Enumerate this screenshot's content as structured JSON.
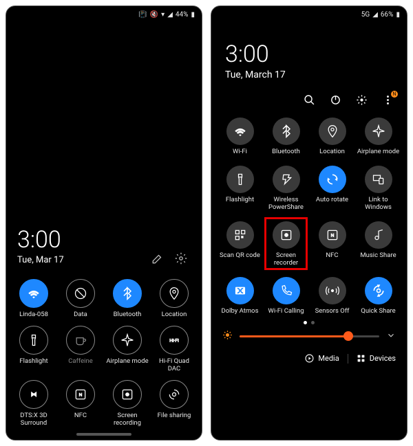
{
  "left": {
    "status": {
      "battery": "44%"
    },
    "clock": {
      "time": "3:00",
      "date": "Tue, Mar 17"
    },
    "tiles": [
      {
        "name": "wifi",
        "label": "Linda-058",
        "active": true
      },
      {
        "name": "data",
        "label": "Data"
      },
      {
        "name": "bluetooth",
        "label": "Bluetooth",
        "active": true
      },
      {
        "name": "location",
        "label": "Location"
      },
      {
        "name": "flashlight",
        "label": "Flashlight"
      },
      {
        "name": "caffeine",
        "label": "Caffeine",
        "dim": true
      },
      {
        "name": "airplane",
        "label": "Airplane mode"
      },
      {
        "name": "hifi",
        "label": "Hi-Fi Quad DAC"
      },
      {
        "name": "dtsx",
        "label": "DTS:X 3D Surround"
      },
      {
        "name": "nfc",
        "label": "NFC"
      },
      {
        "name": "screenrec",
        "label": "Screen recording"
      },
      {
        "name": "fileshare",
        "label": "File sharing"
      }
    ]
  },
  "right": {
    "status": {
      "network": "5G",
      "battery": "66%"
    },
    "clock": {
      "time": "3:00",
      "date": "Tue, March 17"
    },
    "badge": "N",
    "tiles": [
      {
        "name": "wifi",
        "label": "Wi-Fi"
      },
      {
        "name": "bluetooth",
        "label": "Bluetooth"
      },
      {
        "name": "location",
        "label": "Location"
      },
      {
        "name": "airplane",
        "label": "Airplane mode"
      },
      {
        "name": "flashlight",
        "label": "Flashlight"
      },
      {
        "name": "powershare",
        "label": "Wireless PowerShare"
      },
      {
        "name": "autorotate",
        "label": "Auto rotate",
        "active": true
      },
      {
        "name": "linkwin",
        "label": "Link to Windows"
      },
      {
        "name": "qrcode",
        "label": "Scan QR code"
      },
      {
        "name": "screenrec",
        "label": "Screen recorder",
        "highlight": true
      },
      {
        "name": "nfc",
        "label": "NFC"
      },
      {
        "name": "musicshare",
        "label": "Music Share"
      },
      {
        "name": "dolby",
        "label": "Dolby Atmos",
        "active": true
      },
      {
        "name": "wificall",
        "label": "Wi-Fi Calling",
        "active": true
      },
      {
        "name": "sensors",
        "label": "Sensors Off"
      },
      {
        "name": "quickshare",
        "label": "Quick Share",
        "active": true
      }
    ],
    "brightness_pct": 78,
    "bottom": {
      "media": "Media",
      "devices": "Devices"
    }
  }
}
